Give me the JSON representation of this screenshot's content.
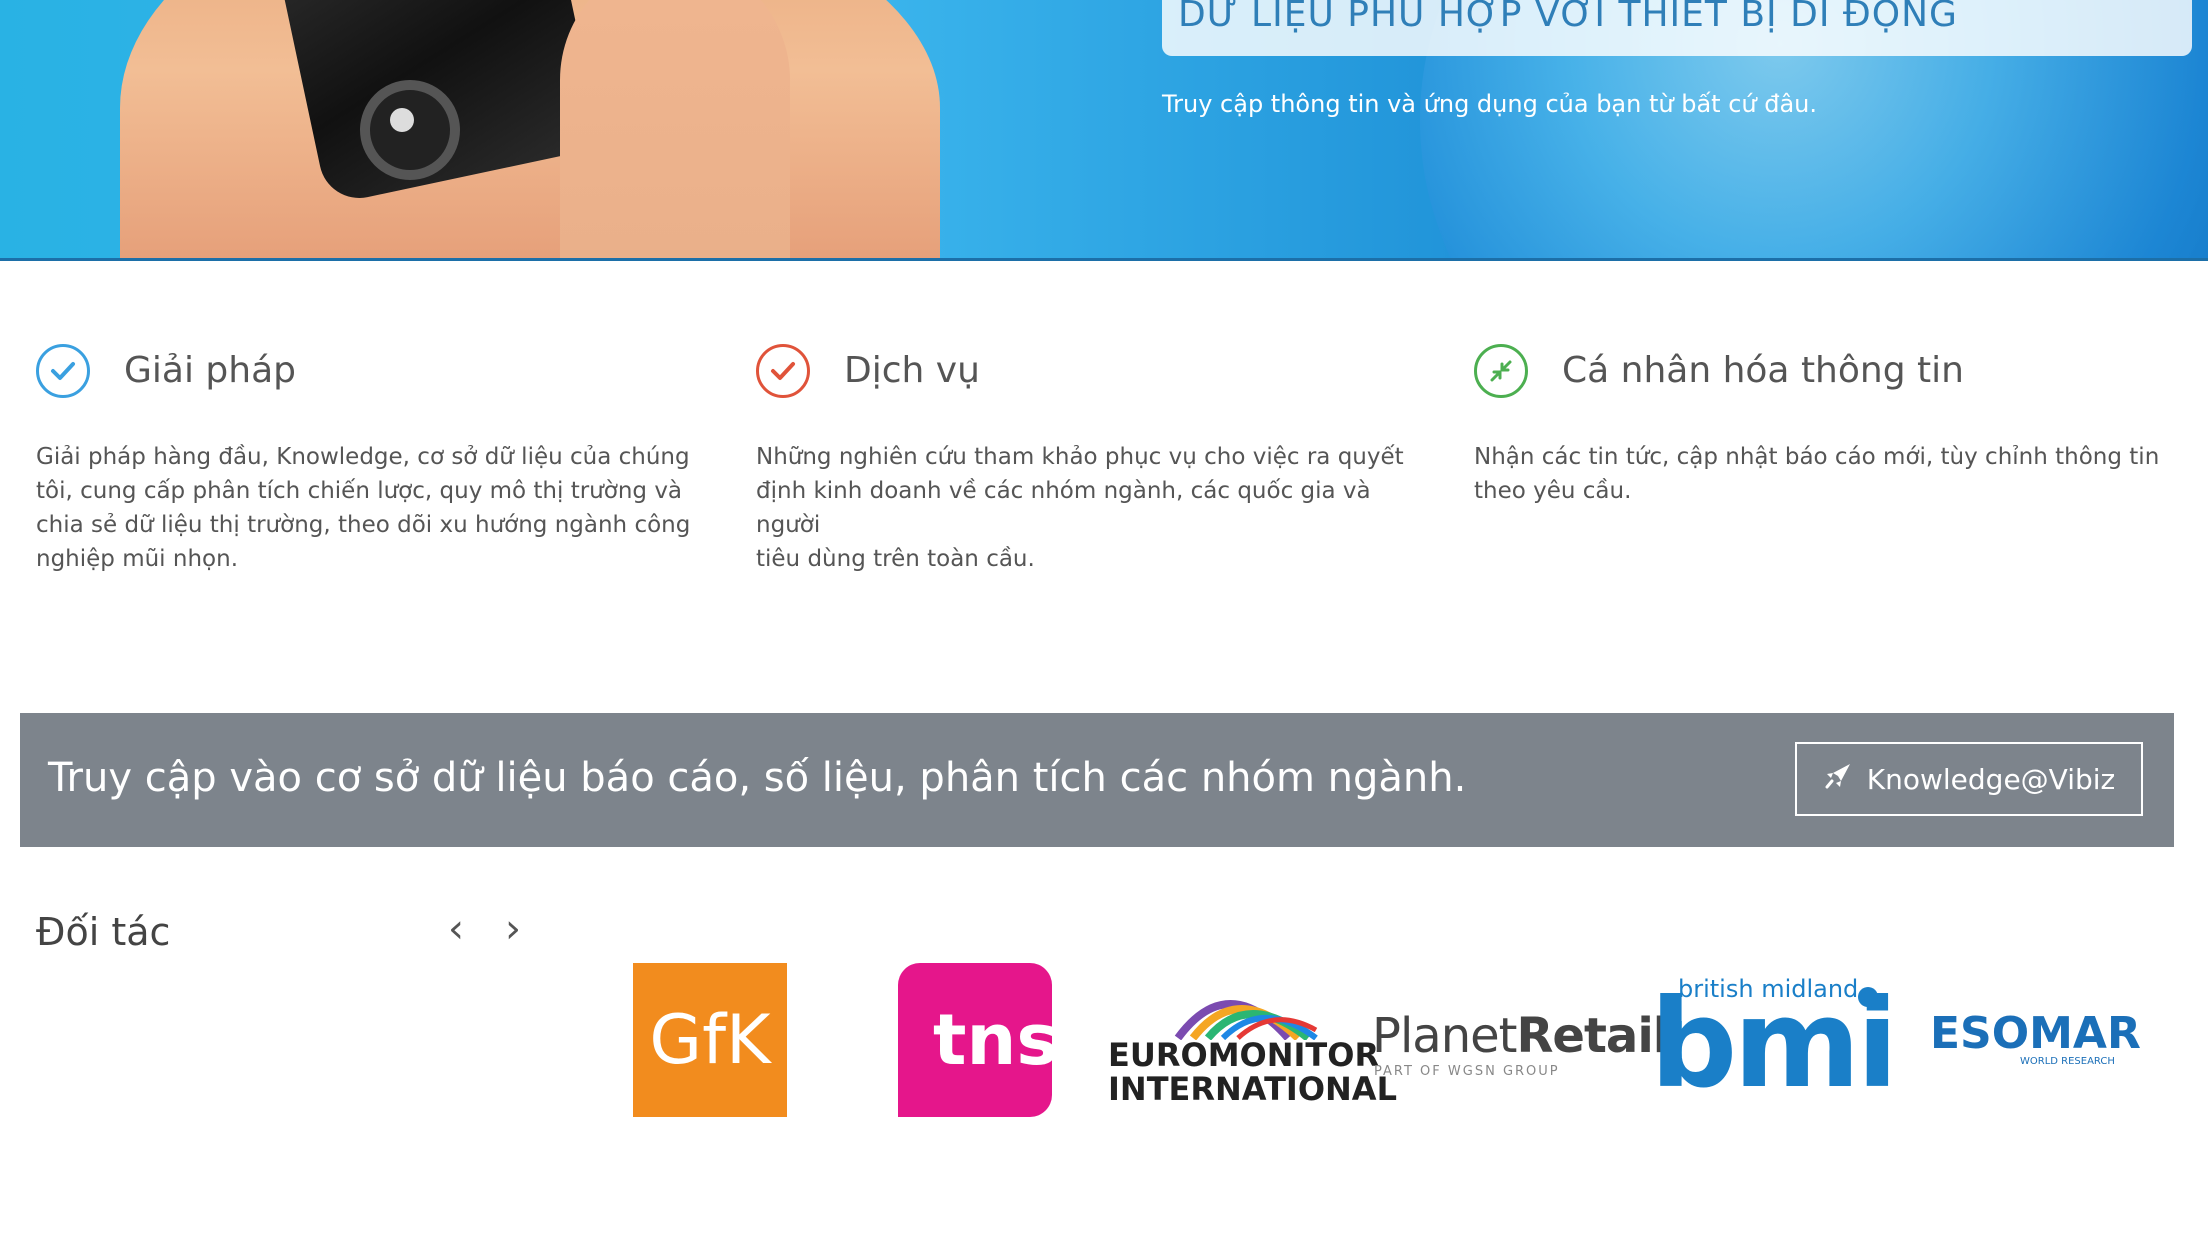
{
  "hero": {
    "title": "DỮ LIỆU PHÙ HỢP VỚI THIẾT BỊ DI ĐỘNG",
    "subtitle": "Truy cập thông tin và ứng dụng của bạn từ bất cứ đâu."
  },
  "features": [
    {
      "icon": "check-circle-icon",
      "color": "#3aa0e0",
      "title": "Giải pháp",
      "desc_lines": [
        "Giải pháp hàng đầu, Knowledge, cơ sở dữ liệu của chúng",
        "tôi, cung cấp phân tích chiến lược, quy mô thị trường và",
        "chia sẻ dữ liệu thị trường, theo dõi xu hướng ngành công",
        "nghiệp mũi nhọn."
      ]
    },
    {
      "icon": "check-circle-icon",
      "color": "#e0533a",
      "title": "Dịch vụ",
      "desc_lines": [
        "Những nghiên cứu tham khảo phục vụ cho việc ra quyết",
        "định kinh doanh về các nhóm ngành, các quốc gia và người",
        "tiêu dùng trên toàn cầu."
      ]
    },
    {
      "icon": "compress-arrows-icon",
      "color": "#4caf50",
      "title": "Cá nhân hóa thông tin",
      "desc_lines": [
        "Nhận các tin tức, cập nhật báo cáo mới, tùy chỉnh thông tin",
        "theo yêu cầu."
      ]
    }
  ],
  "cta": {
    "text": "Truy cập vào cơ sở dữ liệu báo cáo, số liệu, phân tích các nhóm ngành.",
    "button_label": "Knowledge@Vibiz",
    "button_icon": "rocket-icon"
  },
  "partners": {
    "title": "Đối tác",
    "prev": "‹",
    "next": "›",
    "logos": {
      "gfk": "GfK",
      "tns": "tns",
      "euromonitor_line1": "EUROMONITOR",
      "euromonitor_line2": "INTERNATIONAL",
      "planet_retail_a": "Planet",
      "planet_retail_b": "Retail",
      "planet_retail_sub": "PART OF WGSN GROUP",
      "bmi_small": "british midland",
      "bmi_big": "bmi",
      "esomar": "ESOMAR",
      "esomar_sub": "WORLD RESEARCH"
    }
  },
  "colors": {
    "cta_bg": "#7d848c",
    "gfk": "#f28c1e",
    "tns": "#e5168b",
    "bmi": "#1a7fc8",
    "esomar": "#1b6fb8"
  }
}
